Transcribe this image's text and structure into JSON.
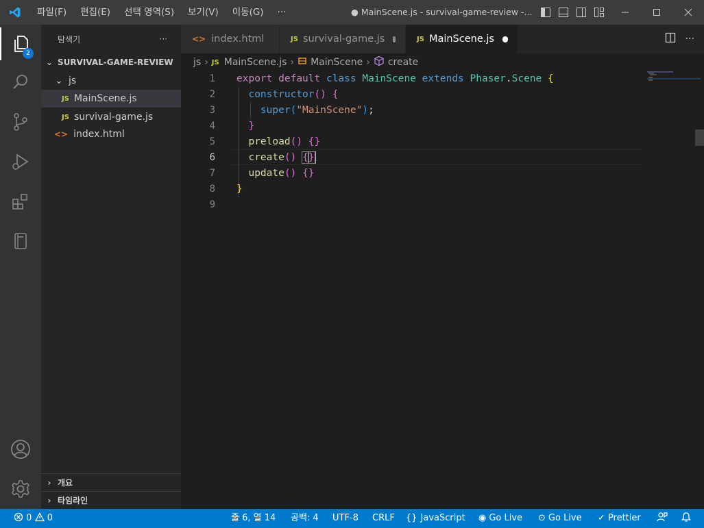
{
  "titlebar": {
    "menu": [
      "파일(F)",
      "편집(E)",
      "선택 영역(S)",
      "보기(V)",
      "이동(G)",
      "···"
    ],
    "window_title": "● MainScene.js - survival-game-review -..."
  },
  "activity": {
    "explorer_badge": "2"
  },
  "sidebar": {
    "title": "탐색기",
    "more": "···",
    "root": "SURVIVAL-GAME-REVIEW",
    "folder": "js",
    "files": [
      {
        "icon": "JS",
        "name": "MainScene.js"
      },
      {
        "icon": "JS",
        "name": "survival-game.js"
      },
      {
        "icon": "<>",
        "name": "index.html"
      }
    ],
    "panels": [
      "개요",
      "타임라인"
    ]
  },
  "tabs": [
    {
      "icon": "<>",
      "label": "index.html"
    },
    {
      "icon": "JS",
      "label": "survival-game.js"
    },
    {
      "icon": "JS",
      "label": "MainScene.js"
    }
  ],
  "breadcrumb": {
    "folder": "js",
    "file_icon": "JS",
    "file": "MainScene.js",
    "class": "MainScene",
    "method": "create"
  },
  "editor": {
    "line_numbers": [
      "1",
      "2",
      "3",
      "4",
      "5",
      "6",
      "7",
      "8",
      "9"
    ],
    "current_line": 6
  },
  "code": {
    "l1": [
      "export",
      "default",
      "class",
      "MainScene",
      "extends",
      "Phaser",
      ".",
      "Scene",
      "{"
    ],
    "l2": [
      "constructor",
      "(",
      ")",
      "{"
    ],
    "l3": [
      "super",
      "(",
      "\"MainScene\"",
      ")",
      ";"
    ],
    "l4": [
      "}"
    ],
    "l5": [
      "preload",
      "(",
      ")",
      "{",
      "}"
    ],
    "l6": [
      "create",
      "(",
      ")",
      "{",
      "}"
    ],
    "l7": [
      "update",
      "(",
      ")",
      "{",
      "}"
    ],
    "l8": [
      "}"
    ]
  },
  "statusbar": {
    "errors": "0",
    "warnings": "0",
    "position": "줄 6, 열 14",
    "spaces": "공백: 4",
    "encoding": "UTF-8",
    "eol": "CRLF",
    "language": "JavaScript",
    "golive1": "Go Live",
    "golive2": "Go Live",
    "prettier": "Prettier"
  },
  "colors": {
    "accent": "#007acc",
    "titlebar": "#3c3c3c",
    "sidebar": "#252526",
    "editor": "#1e1e1e",
    "keyword": "#c586c0",
    "storage": "#569cd6",
    "class": "#4ec9b0",
    "function": "#dcdcaa",
    "string": "#ce9178"
  }
}
